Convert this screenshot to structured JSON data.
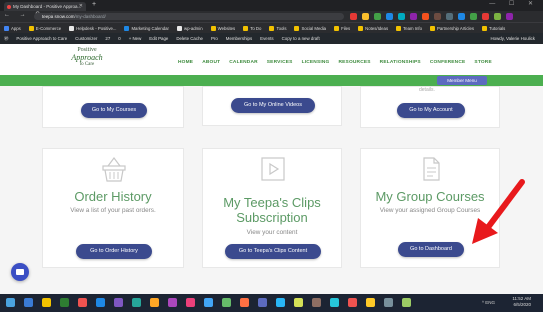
{
  "browser": {
    "tab_title": "My Dashboard - Positive Approa...",
    "new_tab": "+",
    "url_host": "teepa snow.com",
    "url_path": "/my-dashboard/",
    "nav_glyphs": "← → C ⌂",
    "window_controls": "— ☐ ✕"
  },
  "bookmarks": [
    "Apps",
    "E-Commerce",
    "Helpdesk - Positive...",
    "Marketing Calendar",
    "wp-admin",
    "Websites",
    "To Do",
    "Tools",
    "Social Media",
    "Files",
    "Notes/Ideas",
    "Team Info",
    "Partnership Articles",
    "Tutorials"
  ],
  "wp_admin_bar": {
    "items": [
      "Positive Approach to Care",
      "Customizer",
      "27",
      "0",
      "+ New",
      "Edit Page",
      "Delete Cache",
      "Pro",
      "Memberships",
      "Events",
      "Copy to a new draft"
    ],
    "howdy": "Howdy, Valerie Houlick"
  },
  "site": {
    "logo_top": "Positive",
    "logo_mid": "Approach",
    "logo_bot": "to Care",
    "menu": [
      "HOME",
      "ABOUT",
      "CALENDAR",
      "SERVICES",
      "LICENSING",
      "RESOURCES",
      "RELATIONSHIPS",
      "CONFERENCE",
      "STORE"
    ],
    "member_menu": "Member Menu"
  },
  "cards": {
    "my_courses_button": "Go to My Courses",
    "online_videos_button": "Go to My Online Videos",
    "my_account_partial": "details.",
    "my_account_button": "Go to My Account",
    "order_history": {
      "title": "Order History",
      "desc": "View a list of your past orders.",
      "button": "Go to Order History",
      "icon": "basket-icon"
    },
    "clips": {
      "title": "My Teepa's Clips Subscription",
      "desc": "View your content",
      "button": "Go to Teepa's Clips Content",
      "icon": "play-icon"
    },
    "group_courses": {
      "title": "My Group Courses",
      "desc": "View your assigned Group Courses",
      "button": "Go to Dashboard",
      "icon": "document-icon"
    }
  },
  "annotation": {
    "arrow_color": "#e8191c"
  },
  "taskbar": {
    "tray": "^ ENG",
    "time": "11:52 AM",
    "date": "6/5/2020"
  },
  "colors": {
    "brand_green": "#4caf50",
    "button_navy": "#3b4a8e",
    "title_green": "#5c9a65"
  }
}
